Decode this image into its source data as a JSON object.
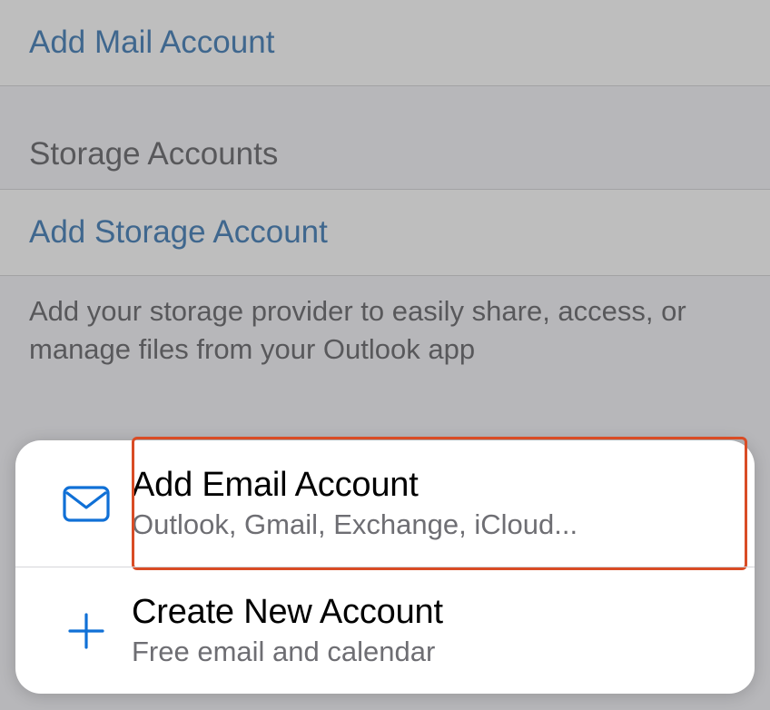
{
  "mailSection": {
    "addMailLabel": "Add Mail Account"
  },
  "storageSection": {
    "header": "Storage Accounts",
    "addStorageLabel": "Add Storage Account",
    "footer": "Add your storage provider to easily share, access, or manage files from your Outlook app"
  },
  "actionSheet": {
    "addEmail": {
      "title": "Add Email Account",
      "subtitle": "Outlook, Gmail, Exchange, iCloud..."
    },
    "createNew": {
      "title": "Create New Account",
      "subtitle": "Free email and calendar"
    }
  },
  "colors": {
    "link": "#0c59a3",
    "iconBlue": "#1070d6",
    "highlight": "#d94c25"
  }
}
